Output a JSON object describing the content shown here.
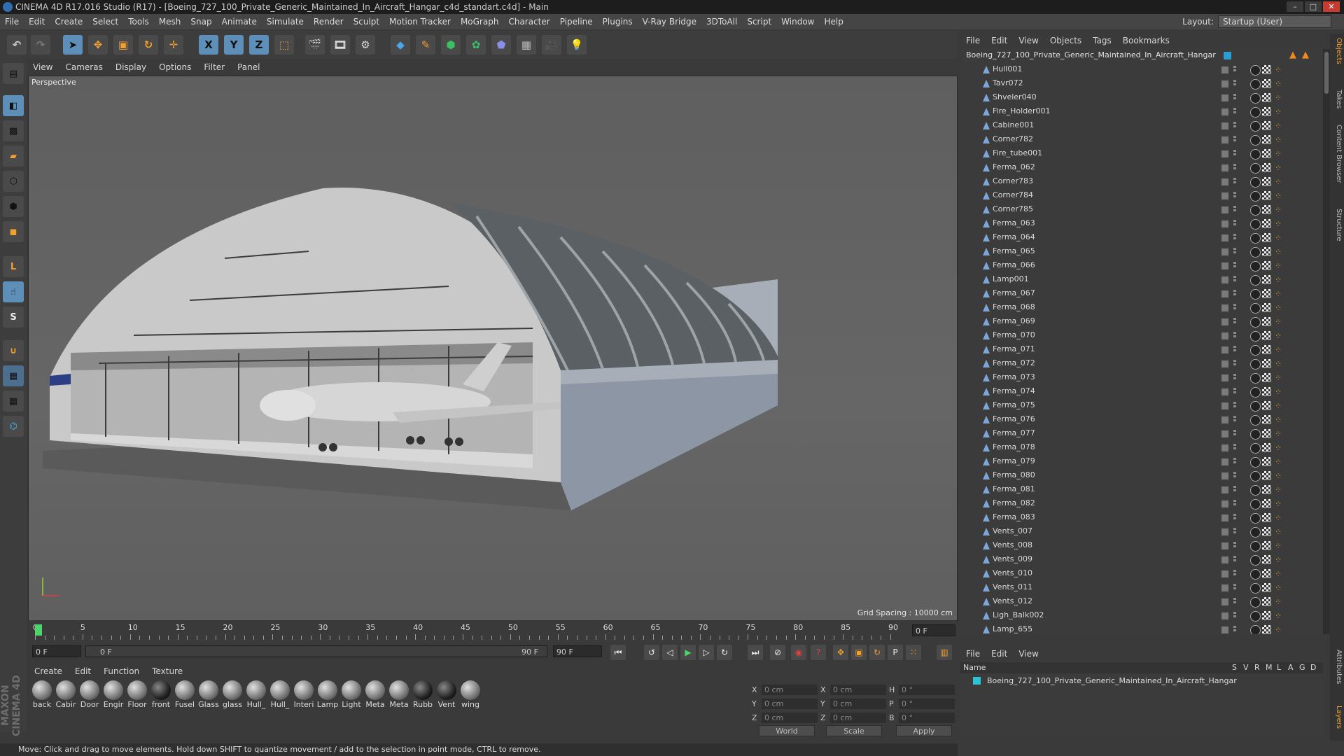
{
  "titlebar": {
    "title": "CINEMA 4D R17.016 Studio (R17) - [Boeing_727_100_Private_Generic_Maintained_In_Aircraft_Hangar_c4d_standart.c4d] - Main"
  },
  "menu": [
    "File",
    "Edit",
    "Create",
    "Select",
    "Tools",
    "Mesh",
    "Snap",
    "Animate",
    "Simulate",
    "Render",
    "Sculpt",
    "Motion Tracker",
    "MoGraph",
    "Character",
    "Pipeline",
    "Plugins",
    "V-Ray Bridge",
    "3DToAll",
    "Script",
    "Window",
    "Help"
  ],
  "layout": {
    "label": "Layout:",
    "value": "Startup (User)"
  },
  "viewport_menu": [
    "View",
    "Cameras",
    "Display",
    "Options",
    "Filter",
    "Panel"
  ],
  "viewport": {
    "label": "Perspective",
    "grid_spacing": "Grid Spacing : 10000 cm"
  },
  "timeline": {
    "ticks": [
      "0",
      "5",
      "10",
      "15",
      "20",
      "25",
      "30",
      "35",
      "40",
      "45",
      "50",
      "55",
      "60",
      "65",
      "70",
      "75",
      "80",
      "85",
      "90"
    ],
    "current": "0 F"
  },
  "transport": {
    "start": "0 F",
    "range_start": "0 F",
    "range_end": "90 F",
    "end": "90 F"
  },
  "material_menu": [
    "Create",
    "Edit",
    "Function",
    "Texture"
  ],
  "materials": [
    "back",
    "Cabir",
    "Door",
    "Engir",
    "Floor",
    "front",
    "Fusel",
    "Glass",
    "glass",
    "Hull_",
    "Hull_",
    "Interi",
    "Lamp",
    "Light",
    "Meta",
    "Meta",
    "Rubb",
    "Vent",
    "wing"
  ],
  "coords": {
    "rows": [
      {
        "a": "X",
        "av": "0 cm",
        "b": "X",
        "bv": "0 cm",
        "c": "H",
        "cv": "0 °"
      },
      {
        "a": "Y",
        "av": "0 cm",
        "b": "Y",
        "bv": "0 cm",
        "c": "P",
        "cv": "0 °"
      },
      {
        "a": "Z",
        "av": "0 cm",
        "b": "Z",
        "bv": "0 cm",
        "c": "B",
        "cv": "0 °"
      }
    ],
    "world": "World",
    "scale": "Scale",
    "apply": "Apply"
  },
  "status": "Move: Click and drag to move elements. Hold down SHIFT to quantize movement / add to the selection in point mode, CTRL to remove.",
  "brand": "MAXON CINEMA 4D",
  "object_menu": [
    "File",
    "Edit",
    "View",
    "Objects",
    "Tags",
    "Bookmarks"
  ],
  "object_root": "Boeing_727_100_Private_Generic_Maintained_In_Aircraft_Hangar",
  "objects": [
    "Hull001",
    "Tavr072",
    "Shveler040",
    "Fire_Holder001",
    "Cabine001",
    "Corner782",
    "Fire_tube001",
    "Ferma_062",
    "Corner783",
    "Corner784",
    "Corner785",
    "Ferma_063",
    "Ferma_064",
    "Ferma_065",
    "Ferma_066",
    "Lamp001",
    "Ferma_067",
    "Ferma_068",
    "Ferma_069",
    "Ferma_070",
    "Ferma_071",
    "Ferma_072",
    "Ferma_073",
    "Ferma_074",
    "Ferma_075",
    "Ferma_076",
    "Ferma_077",
    "Ferma_078",
    "Ferma_079",
    "Ferma_080",
    "Ferma_081",
    "Ferma_082",
    "Ferma_083",
    "Vents_007",
    "Vents_008",
    "Vents_009",
    "Vents_010",
    "Vents_011",
    "Vents_012",
    "Ligh_Balk002",
    "Lamp_655"
  ],
  "right_tabs": [
    "Objects",
    "Takes",
    "Content Browser",
    "Structure",
    "Attributes",
    "Layers"
  ],
  "layer_menu": [
    "File",
    "Edit",
    "View"
  ],
  "layer_header": {
    "name": "Name",
    "cols": [
      "S",
      "V",
      "R",
      "M",
      "L",
      "A",
      "G",
      "D"
    ]
  },
  "layer_row": "Boeing_727_100_Private_Generic_Maintained_In_Aircraft_Hangar",
  "colors": {
    "accent": "#2a9fd6",
    "orange": "#f08a1c",
    "layer_swatch": "#29c4d4"
  }
}
